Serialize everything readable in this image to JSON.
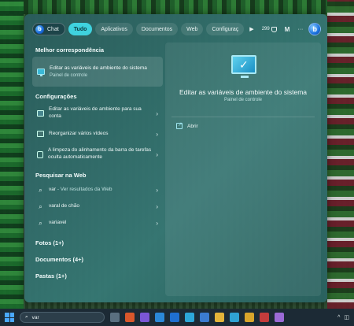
{
  "filters": {
    "chat": "Chat",
    "tudo": "Tudo",
    "aplicativos": "Aplicativos",
    "documentos": "Documentos",
    "web": "Web",
    "configuracoes": "Configuraç",
    "points": "299",
    "account_initial": "M",
    "more": "···"
  },
  "best_match": {
    "section_title": "Melhor correspondência",
    "title": "Editar as variáveis de ambiente do sistema",
    "subtitle": "Painel de controle"
  },
  "settings": {
    "section_title": "Configurações",
    "items": [
      {
        "label": "Editar as variáveis de ambiente para sua conta"
      },
      {
        "label": "Reorganizar vários vídeos"
      },
      {
        "label": "A limpeza do alinhamento da barra de tarefas oculta automaticamente"
      }
    ]
  },
  "web": {
    "section_title": "Pesquisar na Web",
    "items": [
      {
        "term": "var",
        "sub": " - Ver resultados da Web"
      },
      {
        "term": "varal de chão",
        "sub": ""
      },
      {
        "term": "variavel",
        "sub": ""
      }
    ]
  },
  "groups": {
    "fotos": "Fotos (1+)",
    "documentos": "Documentos (4+)",
    "pastas": "Pastas (1+)"
  },
  "detail": {
    "title": "Editar as variáveis de ambiente do sistema",
    "subtitle": "Painel de controle",
    "open_label": "Abrir"
  },
  "taskbar": {
    "search_value": "var"
  },
  "colors": {
    "accent": "#3fd2de",
    "panel": "#2f6f6c",
    "taskbar": "#1c2a35"
  }
}
